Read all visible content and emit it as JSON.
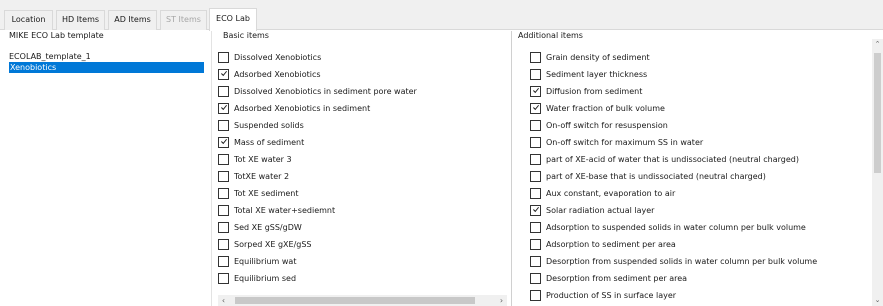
{
  "tabs": [
    {
      "label": "Location",
      "state": "normal"
    },
    {
      "label": "HD Items",
      "state": "normal"
    },
    {
      "label": "AD Items",
      "state": "normal"
    },
    {
      "label": "ST Items",
      "state": "disabled"
    },
    {
      "label": "ECO Lab",
      "state": "active"
    }
  ],
  "template_panel": {
    "title": "MIKE ECO Lab template",
    "items": [
      {
        "label": "ECOLAB_template_1",
        "selected": false
      },
      {
        "label": "Xenobiotics",
        "selected": true
      }
    ]
  },
  "basic_items": {
    "title": "Basic items",
    "items": [
      {
        "label": "Dissolved Xenobiotics",
        "checked": false
      },
      {
        "label": "Adsorbed Xenobiotics",
        "checked": true
      },
      {
        "label": "Dissolved Xenobiotics in sediment pore water",
        "checked": false
      },
      {
        "label": "Adsorbed Xenobiotics in sediment",
        "checked": true
      },
      {
        "label": "Suspended solids",
        "checked": false
      },
      {
        "label": "Mass of sediment",
        "checked": true
      },
      {
        "label": "Tot XE water 3",
        "checked": false
      },
      {
        "label": "TotXE water 2",
        "checked": false
      },
      {
        "label": "Tot XE sediment",
        "checked": false
      },
      {
        "label": "Total XE water+sediemnt",
        "checked": false
      },
      {
        "label": "Sed XE gSS/gDW",
        "checked": false
      },
      {
        "label": "Sorped XE gXE/gSS",
        "checked": false
      },
      {
        "label": "Equilibrium wat",
        "checked": false
      },
      {
        "label": "Equilibrium sed",
        "checked": false
      }
    ]
  },
  "additional_items": {
    "title": "Additional items",
    "items": [
      {
        "label": "Grain density of sediment",
        "checked": false
      },
      {
        "label": "Sediment layer thickness",
        "checked": false
      },
      {
        "label": "Diffusion from sediment",
        "checked": true
      },
      {
        "label": "Water fraction of bulk volume",
        "checked": true
      },
      {
        "label": "On-off switch for resuspension",
        "checked": false
      },
      {
        "label": "On-off switch for maximum SS in water",
        "checked": false
      },
      {
        "label": "part of XE-acid of water that is undissociated (neutral charged)",
        "checked": false
      },
      {
        "label": "part of XE-base that is undissociated (neutral charged)",
        "checked": false
      },
      {
        "label": "Aux constant, evaporation to air",
        "checked": false
      },
      {
        "label": "Solar radiation actual layer",
        "checked": true
      },
      {
        "label": "Adsorption to suspended solids in water column per bulk volume",
        "checked": false
      },
      {
        "label": "Adsorption to sediment per area",
        "checked": false
      },
      {
        "label": "Desorption from suspended solids in water column per bulk volume",
        "checked": false
      },
      {
        "label": "Desorption from sediment per area",
        "checked": false
      },
      {
        "label": "Production of SS in surface layer",
        "checked": false
      }
    ]
  },
  "scrollbar_icons": {
    "left": "scroll-left-arrow",
    "right": "scroll-right-arrow",
    "up": "scroll-up-arrow",
    "down": "scroll-down-arrow"
  },
  "colors": {
    "selection": "#0078d7",
    "tab_background": "#f0f0f0"
  }
}
